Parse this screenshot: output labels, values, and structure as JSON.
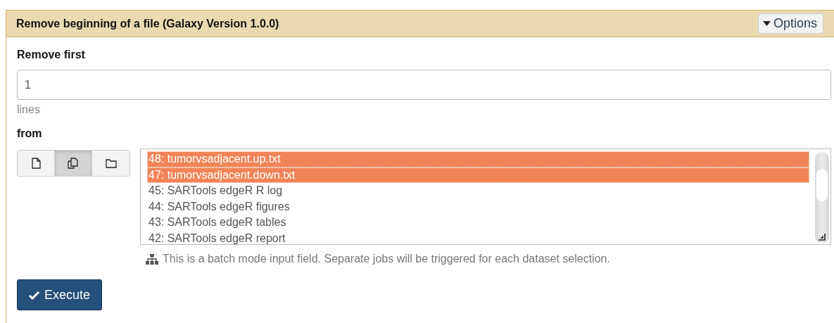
{
  "header": {
    "title": "Remove beginning of a file (Galaxy Version 1.0.0)",
    "options_button": "Options"
  },
  "remove_first": {
    "label": "Remove first",
    "value": "1",
    "help": "lines"
  },
  "from": {
    "label": "from",
    "modes": [
      {
        "kind": "single",
        "selected": false
      },
      {
        "kind": "multiple",
        "selected": true
      },
      {
        "kind": "collection",
        "selected": false
      }
    ],
    "datasets": [
      {
        "label": "48: tumorvsadjacent.up.txt",
        "selected": true
      },
      {
        "label": "47: tumorvsadjacent.down.txt",
        "selected": true
      },
      {
        "label": "45: SARTools edgeR R log",
        "selected": false
      },
      {
        "label": "44: SARTools edgeR figures",
        "selected": false
      },
      {
        "label": "43: SARTools edgeR tables",
        "selected": false
      },
      {
        "label": "42: SARTools edgeR report",
        "selected": false
      }
    ],
    "hint": "This is a batch mode input field. Separate jobs will be triggered for each dataset selection."
  },
  "execute_button": "Execute"
}
